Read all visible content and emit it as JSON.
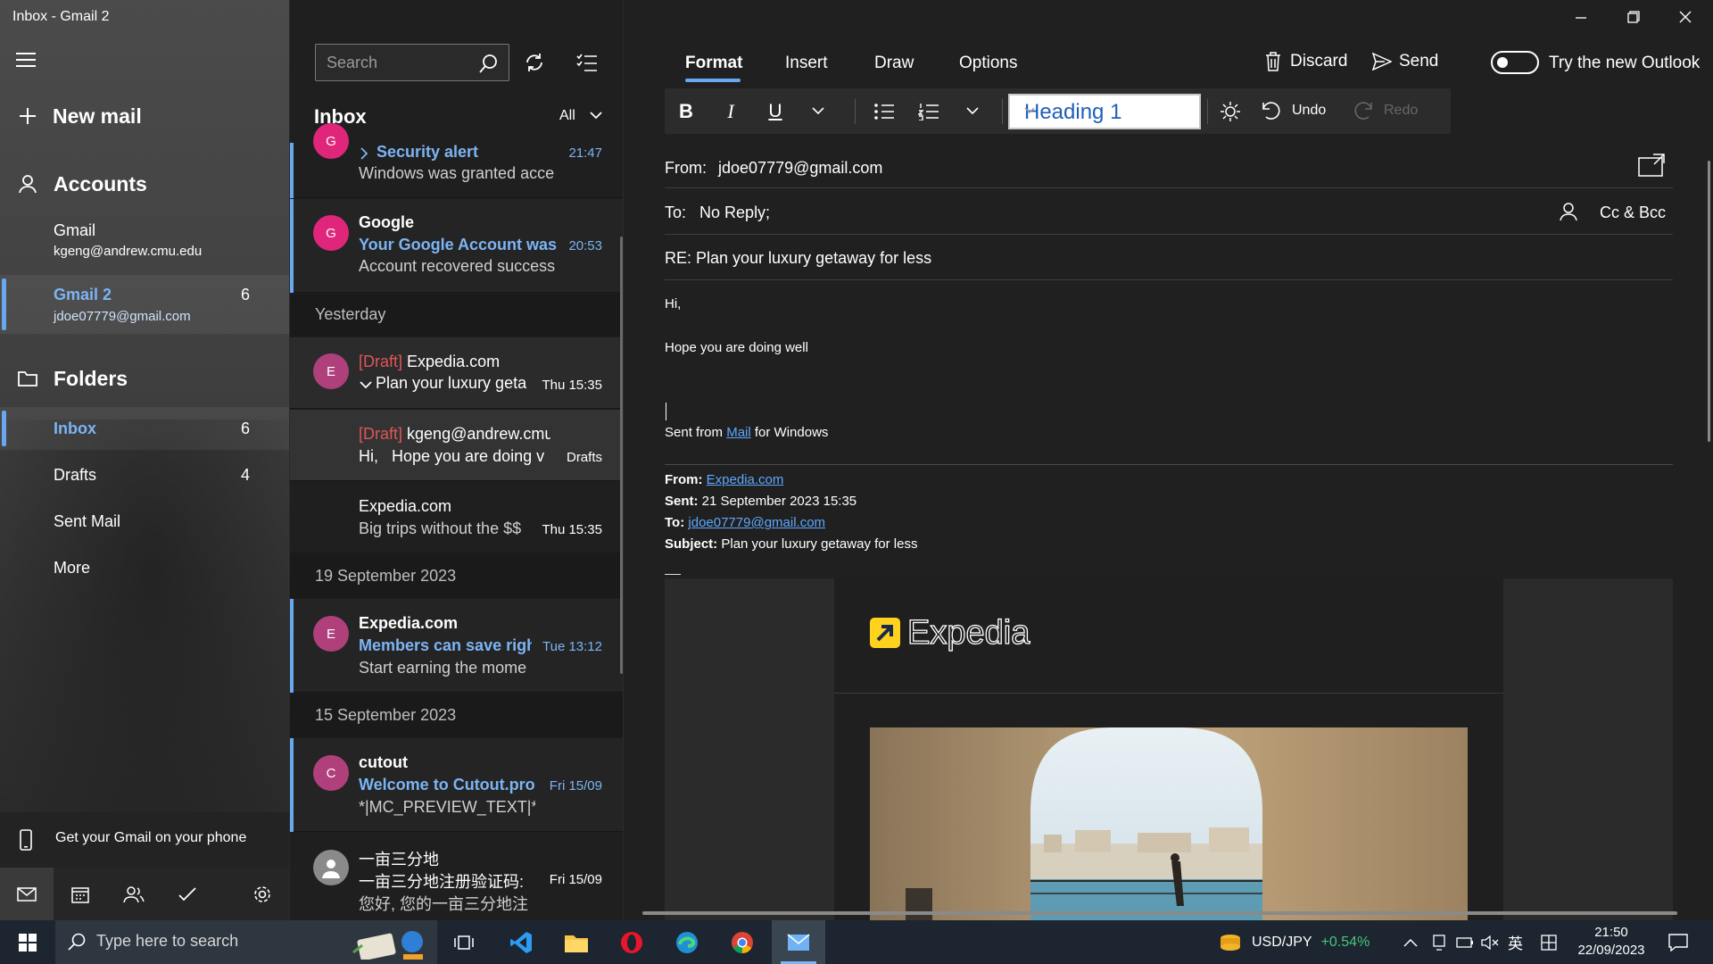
{
  "window": {
    "title": "Inbox - Gmail 2"
  },
  "nav": {
    "new_mail": "New mail",
    "accounts_label": "Accounts",
    "accounts": [
      {
        "name": "Gmail",
        "email": "kgeng@andrew.cmu.edu",
        "count": ""
      },
      {
        "name": "Gmail 2",
        "email": "jdoe07779@gmail.com",
        "count": "6"
      }
    ],
    "folders_label": "Folders",
    "folders": [
      {
        "name": "Inbox",
        "count": "6"
      },
      {
        "name": "Drafts",
        "count": "4"
      },
      {
        "name": "Sent Mail",
        "count": ""
      },
      {
        "name": "More",
        "count": ""
      }
    ],
    "phone_promo": "Get your Gmail on your phone"
  },
  "list": {
    "search_placeholder": "Search",
    "title": "Inbox",
    "filter": "All",
    "items": [
      {
        "avatar": "G",
        "sender": "",
        "subject": "Security alert",
        "preview": "Windows was granted acce",
        "time": "21:47",
        "draft": "",
        "tag": ""
      },
      {
        "avatar": "G",
        "sender": "Google",
        "subject": "Your Google Account was",
        "preview": "Account recovered success",
        "time": "20:53",
        "draft": "",
        "tag": ""
      },
      {
        "avatar": "E",
        "sender": "Expedia.com",
        "subject": "Plan your luxury geta",
        "preview": "",
        "time": "Thu 15:35",
        "draft": "[Draft]",
        "tag": ""
      },
      {
        "avatar": "",
        "sender": "kgeng@andrew.cmu",
        "subject": "",
        "preview": "Hi,   Hope you are doing v",
        "time": "",
        "draft": "[Draft]",
        "tag": "Drafts"
      },
      {
        "avatar": "",
        "sender": "Expedia.com",
        "subject": "",
        "preview": "Big trips without the $$",
        "time": "Thu 15:35",
        "draft": "",
        "tag": ""
      },
      {
        "avatar": "E",
        "sender": "Expedia.com",
        "subject": "Members can save righ",
        "preview": "Start earning the mome",
        "time": "Tue 13:12",
        "draft": "",
        "tag": ""
      },
      {
        "avatar": "C",
        "sender": "cutout",
        "subject": "Welcome to Cutout.pro",
        "preview": "*|MC_PREVIEW_TEXT|* V",
        "time": "Fri 15/09",
        "draft": "",
        "tag": ""
      },
      {
        "avatar": "",
        "sender": "一亩三分地",
        "subject": "一亩三分地注册验证码:",
        "preview": "您好, 您的一亩三分地注",
        "time": "Fri 15/09",
        "draft": "",
        "tag": ""
      }
    ],
    "separators": [
      "Yesterday",
      "19 September 2023",
      "15 September 2023"
    ]
  },
  "compose": {
    "tabs": [
      "Format",
      "Insert",
      "Draw",
      "Options"
    ],
    "discard": "Discard",
    "send": "Send",
    "outlook_toggle": "Try the new Outlook",
    "style": "Heading 1",
    "undo": "Undo",
    "redo": "Redo",
    "from_label": "From:",
    "from_value": "jdoe07779@gmail.com",
    "to_label": "To:",
    "to_value": "No Reply;",
    "cc_bcc": "Cc & Bcc",
    "subject": "RE: Plan your luxury getaway for less",
    "body_line1": "Hi,",
    "body_line2": "Hope you are doing well",
    "signature_prefix": "Sent from ",
    "signature_link": "Mail",
    "signature_suffix": " for Windows",
    "quoted": {
      "from_label": "From:",
      "from_value": "Expedia.com",
      "sent_label": "Sent:",
      "sent_value": "21 September 2023 15:35",
      "to_label": "To:",
      "to_value": "jdoe07779@gmail.com",
      "subject_label": "Subject:",
      "subject_value": "Plan your luxury getaway for less"
    },
    "brand": "Expedia"
  },
  "taskbar": {
    "search_placeholder": "Type here to search",
    "ticker": "USD/JPY",
    "ticker_change": "+0.54%",
    "ime": "英",
    "time": "21:50",
    "date": "22/09/2023"
  },
  "colors": {
    "accent": "#69a8ef",
    "draft": "#e05656",
    "ticker_up": "#49c47a",
    "link": "#5ea7ff"
  }
}
